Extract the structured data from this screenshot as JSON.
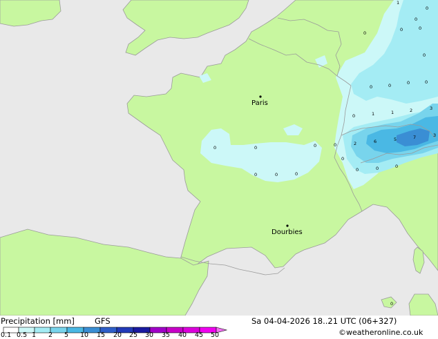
{
  "map": {
    "colors": {
      "sea": "#e9e9e9",
      "land": "#c8f7a0",
      "border": "#9a9a9a",
      "precip_light": "#ccf8f8",
      "precip_moderate": "#a4ecf4",
      "precip_medium": "#78d4ec",
      "precip_heavy": "#4ab8e4",
      "precip_strong": "#3a8ed4"
    },
    "cities": [
      {
        "name": "Paris"
      },
      {
        "name": "Dourbies"
      }
    ],
    "value_labels": [
      "0",
      "0",
      "0",
      "0",
      "0",
      "0",
      "0",
      "0",
      "0",
      "0",
      "0",
      "0",
      "0",
      "1",
      "1",
      "2",
      "3",
      "2",
      "6",
      "5",
      "7",
      "3",
      "0",
      "0",
      "0",
      "0",
      "0",
      "0",
      "0",
      "0",
      "0",
      "0",
      "1"
    ]
  },
  "footer": {
    "title": "Precipitation [mm]",
    "model": "GFS",
    "datetime": "Sa 04-04-2026 18..21 UTC (06+327)",
    "credit": "©weatheronline.co.uk",
    "colorbar": {
      "ticks": [
        "0.1",
        "0.5",
        "1",
        "2",
        "5",
        "10",
        "15",
        "20",
        "25",
        "30",
        "35",
        "40",
        "45",
        "50"
      ],
      "colors": [
        "#ffffff",
        "#ccf8f8",
        "#a4ecf4",
        "#78d4ec",
        "#4ab8e4",
        "#3a8ed4",
        "#2e5ec8",
        "#223ab8",
        "#1a1aa0",
        "#a000c8",
        "#c800c8",
        "#dc00dc",
        "#f000f0",
        "#f070f0"
      ]
    }
  }
}
